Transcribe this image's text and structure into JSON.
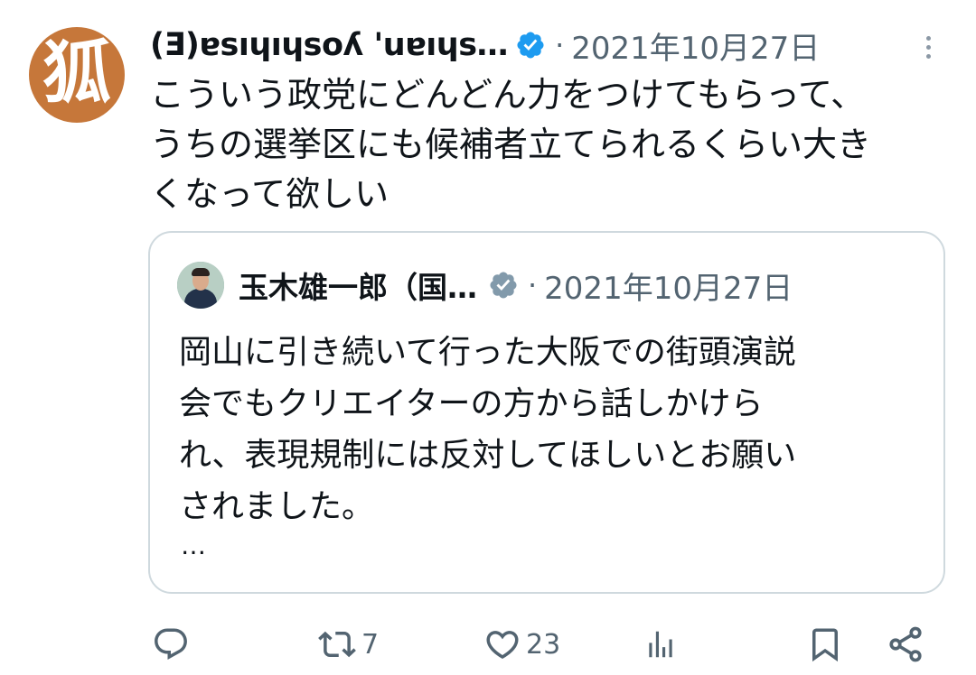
{
  "tweet": {
    "display_name": "(Ǝ)ɐsıɥıɥsoʎ 'uɐıɥs…",
    "avatar_glyph": "狐",
    "avatar_color": "#c6773a",
    "dot": "·",
    "timestamp": "2021年10月27日",
    "text": "こういう政党にどんどん力をつけてもらって、\nうちの選挙区にも候補者立てられるくらい大き\nくなって欲しい"
  },
  "quote": {
    "display_name": "玉木雄一郎（国…",
    "dot": "·",
    "timestamp": "2021年10月27日",
    "text": "岡山に引き続いて行った大阪での街頭演説\n会でもクリエイターの方から話しかけら\nれ、表現規制には反対してほしいとお願い\nされました。",
    "ellipsis": "…"
  },
  "actions": {
    "reply_count": "",
    "retweet_count": "7",
    "like_count": "23",
    "views_count": ""
  },
  "colors": {
    "verified_blue": "#1d9bf0",
    "verified_gray": "#829aab",
    "secondary_text": "#536471",
    "border": "#cfd9de"
  }
}
